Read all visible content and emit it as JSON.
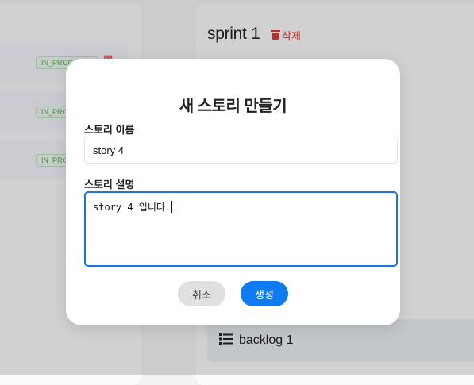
{
  "background": {
    "stories": [
      {
        "status": "IN_PROGRESS"
      },
      {
        "status": "IN_PROGRESS"
      },
      {
        "status": "IN_PROGRESS"
      }
    ],
    "sprint": {
      "title": "sprint 1",
      "delete_label": "삭제"
    },
    "backlog": {
      "label": "backlog 1",
      "icon": "list-icon"
    }
  },
  "modal": {
    "title": "새 스토리 만들기",
    "name_label": "스토리 이름",
    "name_value": "story 4",
    "desc_label": "스토리 설명",
    "desc_value": "story 4 입니다.",
    "cancel_label": "취소",
    "create_label": "생성"
  },
  "colors": {
    "accent": "#0d7cf2",
    "danger": "#e53935",
    "status_green": "#4caf50"
  }
}
